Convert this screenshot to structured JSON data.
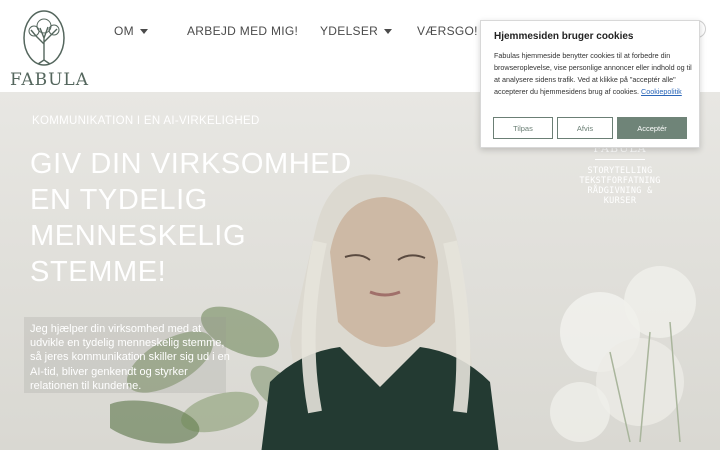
{
  "header": {
    "logo_text": "FABULA",
    "nav": [
      {
        "label": "OM",
        "has_dropdown": true
      },
      {
        "label": "ARBEJD MED MIG!",
        "has_dropdown": false
      },
      {
        "label": "YDELSER",
        "has_dropdown": true
      },
      {
        "label": "VÆRSGO!",
        "has_dropdown": true
      }
    ]
  },
  "hero": {
    "kicker": "KOMMUNIKATION I EN AI-VIRKELIGHED",
    "title": "GIV DIN VIRKSOMHED EN TYDELIG MENNESKELIG STEMME!",
    "body": "Jeg hjælper din virksomhed med at udvikle en tydelig menneskelig stemme, så jeres kommunikation skiller sig ud i en AI-tid, bliver genkendt og styrker relationen til kunderne.",
    "sign": {
      "logo": "FABULA",
      "tagline": [
        "STORYTELLING",
        "TEKSTFORFATNING",
        "RÅDGIVNING & KURSER"
      ]
    }
  },
  "cookie": {
    "title": "Hjemmesiden bruger cookies",
    "text": "Fabulas hjemmeside benytter cookies til at forbedre din browseroplevelse, vise personlige annoncer eller indhold og til at analysere sidens trafik. Ved at klikke på \"acceptér alle\" accepterer du hjemmesidens brug af cookies.",
    "link": "Cookiepolitik",
    "buttons": {
      "customize": "Tilpas",
      "reject": "Afvis",
      "accept": "Acceptér"
    }
  },
  "colors": {
    "brand_green": "#6f8478",
    "logo_green": "#54665d",
    "link_blue": "#2a66b8"
  }
}
